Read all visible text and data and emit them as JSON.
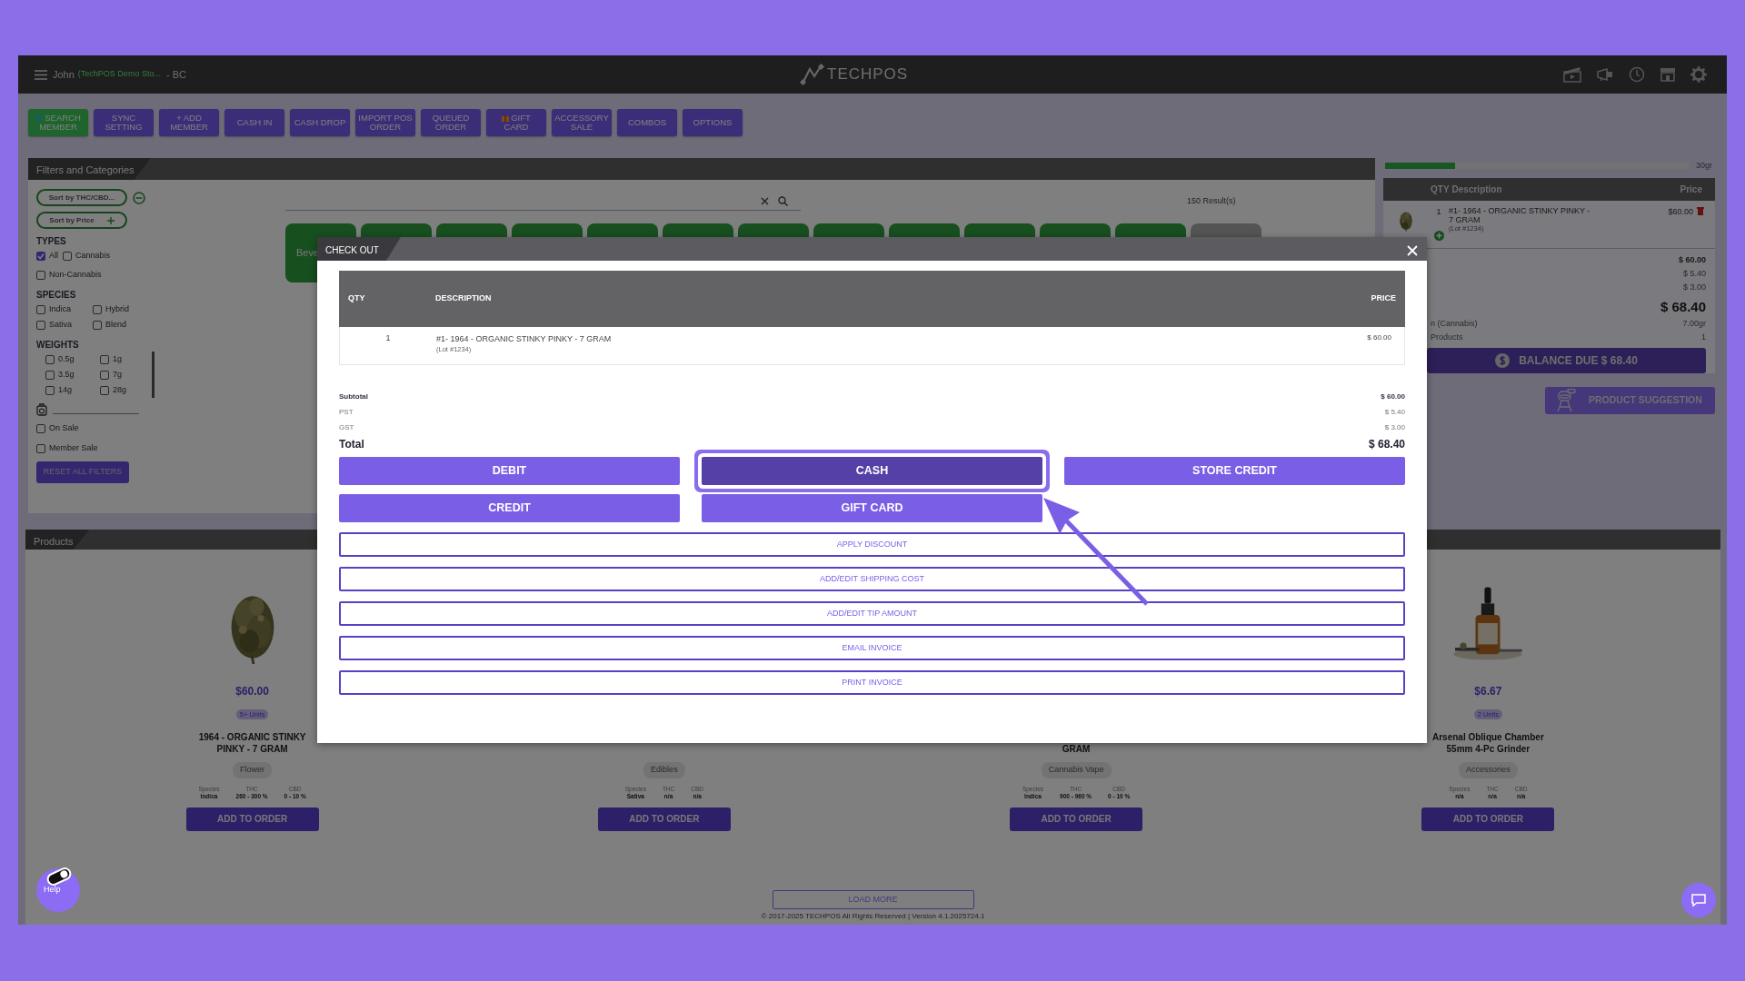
{
  "top_bar": {
    "user": "John",
    "store": "(TechPOS Demo Sto...",
    "region": "- BC",
    "logo": "TECHPOS"
  },
  "toolbar": [
    {
      "label": "SEARCH MEMBER",
      "kind": "search"
    },
    {
      "label": "SYNC SETTING",
      "kind": "plain"
    },
    {
      "label": "+ ADD MEMBER",
      "kind": "plain"
    },
    {
      "label": "CASH IN",
      "kind": "plain"
    },
    {
      "label": "CASH DROP",
      "kind": "plain"
    },
    {
      "label": "IMPORT POS ORDER",
      "kind": "plain"
    },
    {
      "label": "QUEUED ORDER",
      "kind": "plain"
    },
    {
      "label": "GIFT CARD",
      "kind": "gift"
    },
    {
      "label": "ACCESSORY SALE",
      "kind": "plain"
    },
    {
      "label": "COMBOS",
      "kind": "plain"
    },
    {
      "label": "OPTIONS",
      "kind": "plain"
    }
  ],
  "filters": {
    "title": "Filters and Categories",
    "sort_buttons": [
      {
        "label": "Sort by THC/CBD...",
        "kind": "collapse"
      },
      {
        "label": "Sort by Price",
        "kind": "expand"
      }
    ],
    "groups": [
      {
        "title": "TYPES",
        "kind": "types",
        "options": [
          {
            "label": "All",
            "checked": true
          },
          {
            "label": "Cannabis",
            "checked": false
          },
          {
            "label": "Non-Cannabis",
            "checked": false
          }
        ]
      },
      {
        "title": "SPECIES",
        "kind": "grid",
        "options": [
          {
            "label": "Indica",
            "checked": false
          },
          {
            "label": "Hybrid",
            "checked": false
          },
          {
            "label": "Sativa",
            "checked": false
          },
          {
            "label": "Blend",
            "checked": false
          }
        ]
      },
      {
        "title": "WEIGHTS",
        "kind": "weights",
        "options": [
          {
            "label": "0.5g",
            "checked": false
          },
          {
            "label": "1g",
            "checked": false
          },
          {
            "label": "3.5g",
            "checked": false
          },
          {
            "label": "7g",
            "checked": false
          },
          {
            "label": "14g",
            "checked": false
          },
          {
            "label": "28g",
            "checked": false
          }
        ]
      }
    ],
    "toggles": [
      {
        "label": "On Sale",
        "checked": false
      },
      {
        "label": "Member Sale",
        "checked": false
      }
    ],
    "reset": "RESET ALL FILTERS"
  },
  "search": {
    "results": "150 Result(s)"
  },
  "category_tabs": [
    {
      "label": "Beve",
      "kind": "category"
    },
    {
      "kind": "category"
    },
    {
      "kind": "category"
    },
    {
      "kind": "category"
    },
    {
      "kind": "category"
    },
    {
      "kind": "category"
    },
    {
      "kind": "category"
    },
    {
      "kind": "category"
    },
    {
      "kind": "category"
    },
    {
      "kind": "category"
    },
    {
      "kind": "category"
    },
    {
      "kind": "category"
    },
    {
      "kind": "more"
    }
  ],
  "cart": {
    "level": 0.23,
    "limit": "30gr",
    "columns": [
      "QTY",
      "Description",
      "Price"
    ],
    "items": [
      {
        "qty": "1",
        "description": "#1- 1964 - ORGANIC STINKY PINKY - 7 GRAM",
        "lot": "(Lot #1234)",
        "price": "$60.00"
      }
    ],
    "amounts": [
      {
        "value": "$ 60.00",
        "kind": "subtotal"
      },
      {
        "value": "$ 5.40",
        "kind": "tax"
      },
      {
        "value": "$ 3.00",
        "kind": "tax"
      }
    ],
    "total": "$ 68.40",
    "info": [
      {
        "label": "n (Cannabis)",
        "value": "7.00gr"
      },
      {
        "label": "Products",
        "value": "1"
      }
    ],
    "balance_button": "BALANCE DUE $ 68.40"
  },
  "suggestion_button": "PRODUCT SUGGESTION",
  "products": {
    "title": "Products",
    "cards": [
      {
        "image": {
          "kind": "picture"
        },
        "price": "$60.00",
        "units": "5+ Units",
        "name": "1964 - ORGANIC STINKY PINKY - 7 GRAM",
        "category": "Flower",
        "stats": [
          {
            "label": "Species",
            "value": "Indica"
          },
          {
            "label": "THC",
            "value": "260 - 300 %"
          },
          {
            "label": "CBD",
            "value": "0 - 10 %"
          }
        ],
        "button": "ADD TO ORDER"
      },
      {
        "category": "Edibles",
        "stats": [
          {
            "label": "Species",
            "value": "Sativa"
          },
          {
            "label": "THC",
            "value": "n/a"
          },
          {
            "label": "CBD",
            "value": "n/a"
          }
        ],
        "button": "ADD TO ORDER"
      },
      {
        "name": "GRAM",
        "category": "Cannabis Vape",
        "stats": [
          {
            "label": "Species",
            "value": "Indica"
          },
          {
            "label": "THC",
            "value": "900 - 960 %"
          },
          {
            "label": "CBD",
            "value": "0 - 10 %"
          }
        ],
        "button": "ADD TO ORDER"
      },
      {
        "image": {
          "kind": "picture"
        },
        "price": "$6.67",
        "units": "2 Units",
        "name": "Arsenal Oblique Chamber 55mm 4-Pc Grinder",
        "category": "Accessories",
        "stats": [
          {
            "label": "Species",
            "value": "n/a"
          },
          {
            "label": "THC",
            "value": "n/a"
          },
          {
            "label": "CBD",
            "value": "n/a"
          }
        ],
        "button": "ADD TO ORDER"
      }
    ],
    "load_more": "LOAD MORE"
  },
  "footer": "© 2017-2025 TECHPOS All Rights Reserved | Version 4.1.2025724.1",
  "help": "Help",
  "modal": {
    "title": "CHECK OUT",
    "columns": [
      "QTY",
      "DESCRIPTION",
      "PRICE"
    ],
    "rows": [
      {
        "qty": "1",
        "description": "#1- 1964 - ORGANIC STINKY PINKY - 7 GRAM",
        "lot": "(Lot #1234)",
        "price": "$ 60.00"
      }
    ],
    "totals": [
      {
        "label": "Subtotal",
        "value": "$ 60.00",
        "kind": "subtotal"
      },
      {
        "label": "PST",
        "value": "$ 5.40",
        "kind": "tax"
      },
      {
        "label": "GST",
        "value": "$ 3.00",
        "kind": "tax"
      },
      {
        "label": "Total",
        "value": "$ 68.40",
        "kind": "total"
      }
    ],
    "payment_methods": [
      {
        "label": "DEBIT",
        "selected": false
      },
      {
        "label": "CASH",
        "selected": true
      },
      {
        "label": "STORE CREDIT",
        "selected": false
      },
      {
        "label": "CREDIT",
        "selected": false
      },
      {
        "label": "GIFT CARD",
        "selected": false
      }
    ],
    "actions": [
      "APPLY DISCOUNT",
      "ADD/EDIT SHIPPING COST",
      "ADD/EDIT TIP AMOUNT",
      "EMAIL INVOICE",
      "PRINT INVOICE"
    ]
  }
}
